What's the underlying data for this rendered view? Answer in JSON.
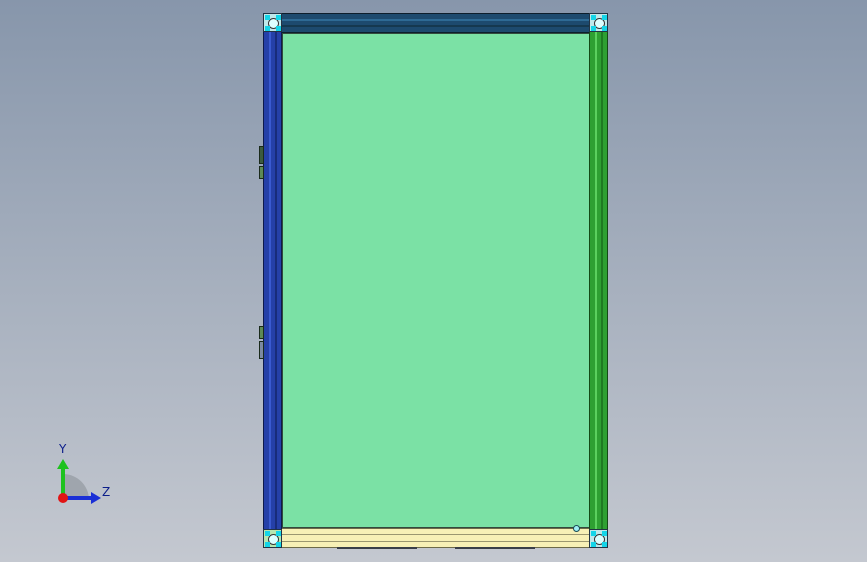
{
  "viewport": {
    "background_top": "#8796ab",
    "background_bottom": "#c4c8d0"
  },
  "model": {
    "panel_color": "#7be1a5",
    "rail_colors": {
      "top": "#1d4a6e",
      "left": "#2540a8",
      "right": "#2ea032",
      "bottom": "#f7f0b6"
    },
    "corner_marker_color": "#14d5e8"
  },
  "triad": {
    "y_label": "Y",
    "z_label": "Z",
    "y_axis_color": "#1ec21e",
    "z_axis_color": "#1a2fd6",
    "origin_color": "#e11414",
    "icons": [
      "triad-y-arrow-icon",
      "triad-z-arrow-icon",
      "triad-origin-icon"
    ]
  }
}
